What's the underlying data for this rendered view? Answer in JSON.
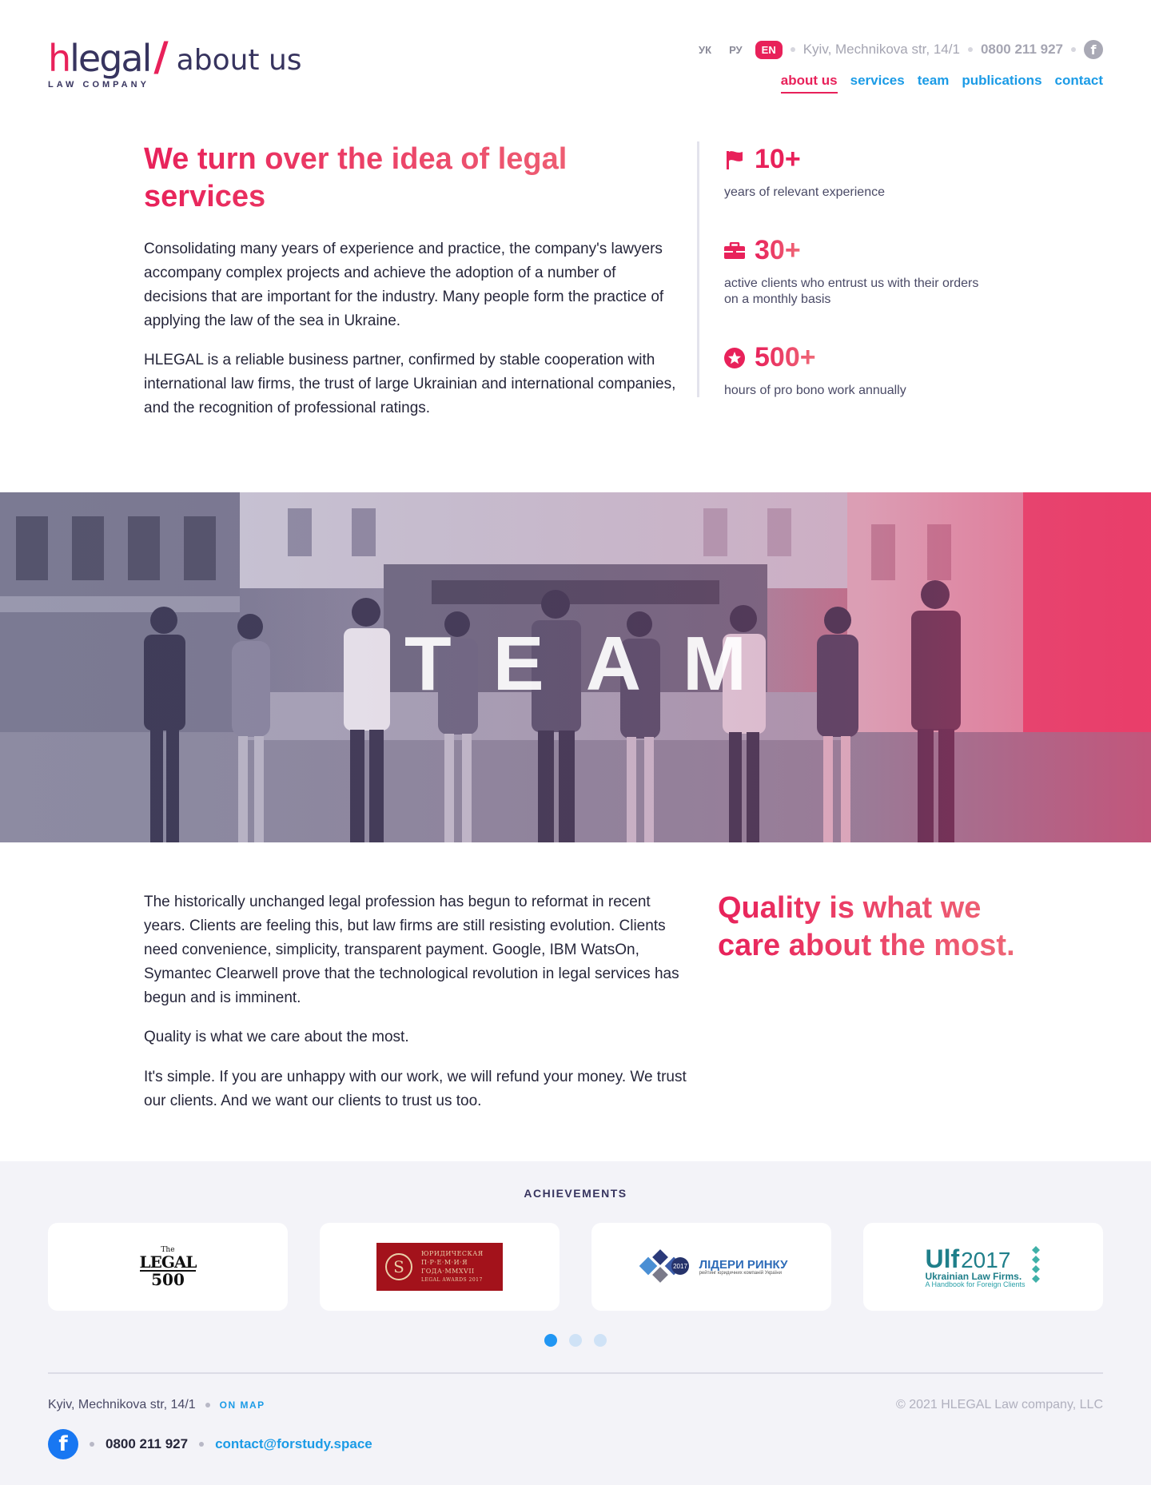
{
  "header": {
    "logo_h": "h",
    "logo_rest": "legal",
    "logo_slash": "/",
    "section": "about us",
    "logo_sub": "LAW COMPANY",
    "langs": [
      {
        "label": "УК",
        "active": false
      },
      {
        "label": "РУ",
        "active": false
      },
      {
        "label": "EN",
        "active": true
      }
    ],
    "address": "Kyiv, Mechnikova str, 14/1",
    "phone": "0800 211 927",
    "facebook_icon": "facebook-icon",
    "nav": [
      {
        "label": "about us",
        "active": true
      },
      {
        "label": "services",
        "active": false
      },
      {
        "label": "team",
        "active": false
      },
      {
        "label": "publications",
        "active": false
      },
      {
        "label": "contact",
        "active": false
      }
    ]
  },
  "intro": {
    "title": "We turn over the idea of legal services",
    "paragraphs": [
      "Consolidating many years of experience and practice, the company's lawyers accompany complex projects and achieve the adoption of a number of decisions that are important for the industry. Many people form the practice of applying the law of the sea in Ukraine.",
      "HLEGAL is a reliable business partner, confirmed by stable cooperation with international law firms, the trust of large Ukrainian and international companies, and the recognition of professional ratings."
    ],
    "stats": [
      {
        "icon": "flag-icon",
        "value": "10+",
        "label": "years of relevant experience"
      },
      {
        "icon": "briefcase-icon",
        "value": "30+",
        "label": "active clients who entrust us with their orders on a monthly basis"
      },
      {
        "icon": "star-icon",
        "value": "500+",
        "label": "hours of pro bono work annually"
      }
    ]
  },
  "hero": {
    "title": "TEAM"
  },
  "quality": {
    "paragraphs": [
      "The historically unchanged legal profession has begun to reformat in recent years. Clients are feeling this, but law firms are still resisting evolution. Clients need convenience, simplicity, transparent payment. Google, IBM WatsOn, Symantec Clearwell prove that the technological revolution in legal services has begun and is imminent.",
      "Quality is what we care about the most.",
      "It's simple. If you are unhappy with our work, we will refund your money. We trust our clients. And we want our clients to trust us too."
    ],
    "quote": "Quality is what we care about the most."
  },
  "achievements": {
    "title": "ACHIEVEMENTS",
    "logos": [
      {
        "name": "legal500-logo",
        "top": "The",
        "mid": "LEGAL",
        "bottom": "500"
      },
      {
        "name": "legal-awards-logo",
        "line1": "ЮРИДИЧЕСКАЯ",
        "line2": "П·Р·Е·М·И·Я",
        "line3": "ГОДА·MMXVII",
        "line4": "LEGAL AWARDS 2017"
      },
      {
        "name": "market-leaders-logo",
        "year": "2017",
        "title": "ЛІДЕРИ РИНКУ",
        "sub": "рейтинг юридичних компаній України"
      },
      {
        "name": "ulf-logo",
        "mark": "Ulf",
        "year": "2017",
        "title": "Ukrainian Law Firms.",
        "sub": "A Handbook for Foreign Clients"
      }
    ],
    "pages": 3,
    "active_page": 1
  },
  "footer": {
    "address": "Kyiv, Mechnikova str, 14/1",
    "map_link": "ON MAP",
    "copyright": "© 2021 HLEGAL Law company, LLC",
    "phone": "0800 211 927",
    "email": "contact@forstudy.space"
  },
  "colors": {
    "accent": "#e8215a",
    "link": "#1b9be6",
    "dark": "#37345f"
  }
}
